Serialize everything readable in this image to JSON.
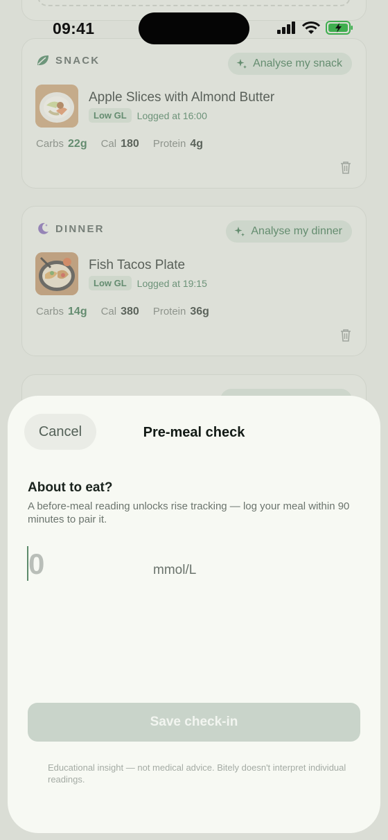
{
  "status_bar": {
    "time": "09:41"
  },
  "meals": [
    {
      "label": "SNACK",
      "icon": "leaf-icon",
      "analyse_label": "Analyse my snack",
      "title": "Apple Slices with Almond Butter",
      "gl_badge": "Low GL",
      "logged": "Logged at 16:00",
      "macros": [
        {
          "label": "Carbs",
          "value": "22g"
        },
        {
          "label": "Cal",
          "value": "180"
        },
        {
          "label": "Protein",
          "value": "4g"
        }
      ]
    },
    {
      "label": "DINNER",
      "icon": "moon-icon",
      "analyse_label": "Analyse my dinner",
      "title": "Fish Tacos Plate",
      "gl_badge": "Low GL",
      "logged": "Logged at 19:15",
      "macros": [
        {
          "label": "Carbs",
          "value": "14g"
        },
        {
          "label": "Cal",
          "value": "380"
        },
        {
          "label": "Protein",
          "value": "36g"
        }
      ]
    }
  ],
  "sheet": {
    "cancel_label": "Cancel",
    "title": "Pre-meal check",
    "heading": "About to eat?",
    "description": "A before-meal reading unlocks rise tracking — log your meal within 90 minutes to pair it.",
    "reading_placeholder": "0",
    "unit": "mmol/L",
    "save_label": "Save check-in",
    "disclaimer": "Educational insight — not medical advice. Bitely doesn't interpret individual readings."
  },
  "colors": {
    "accent_green": "#2f6b44",
    "badge_bg": "#d1ddd0",
    "save_disabled": "#c9d4ca"
  }
}
